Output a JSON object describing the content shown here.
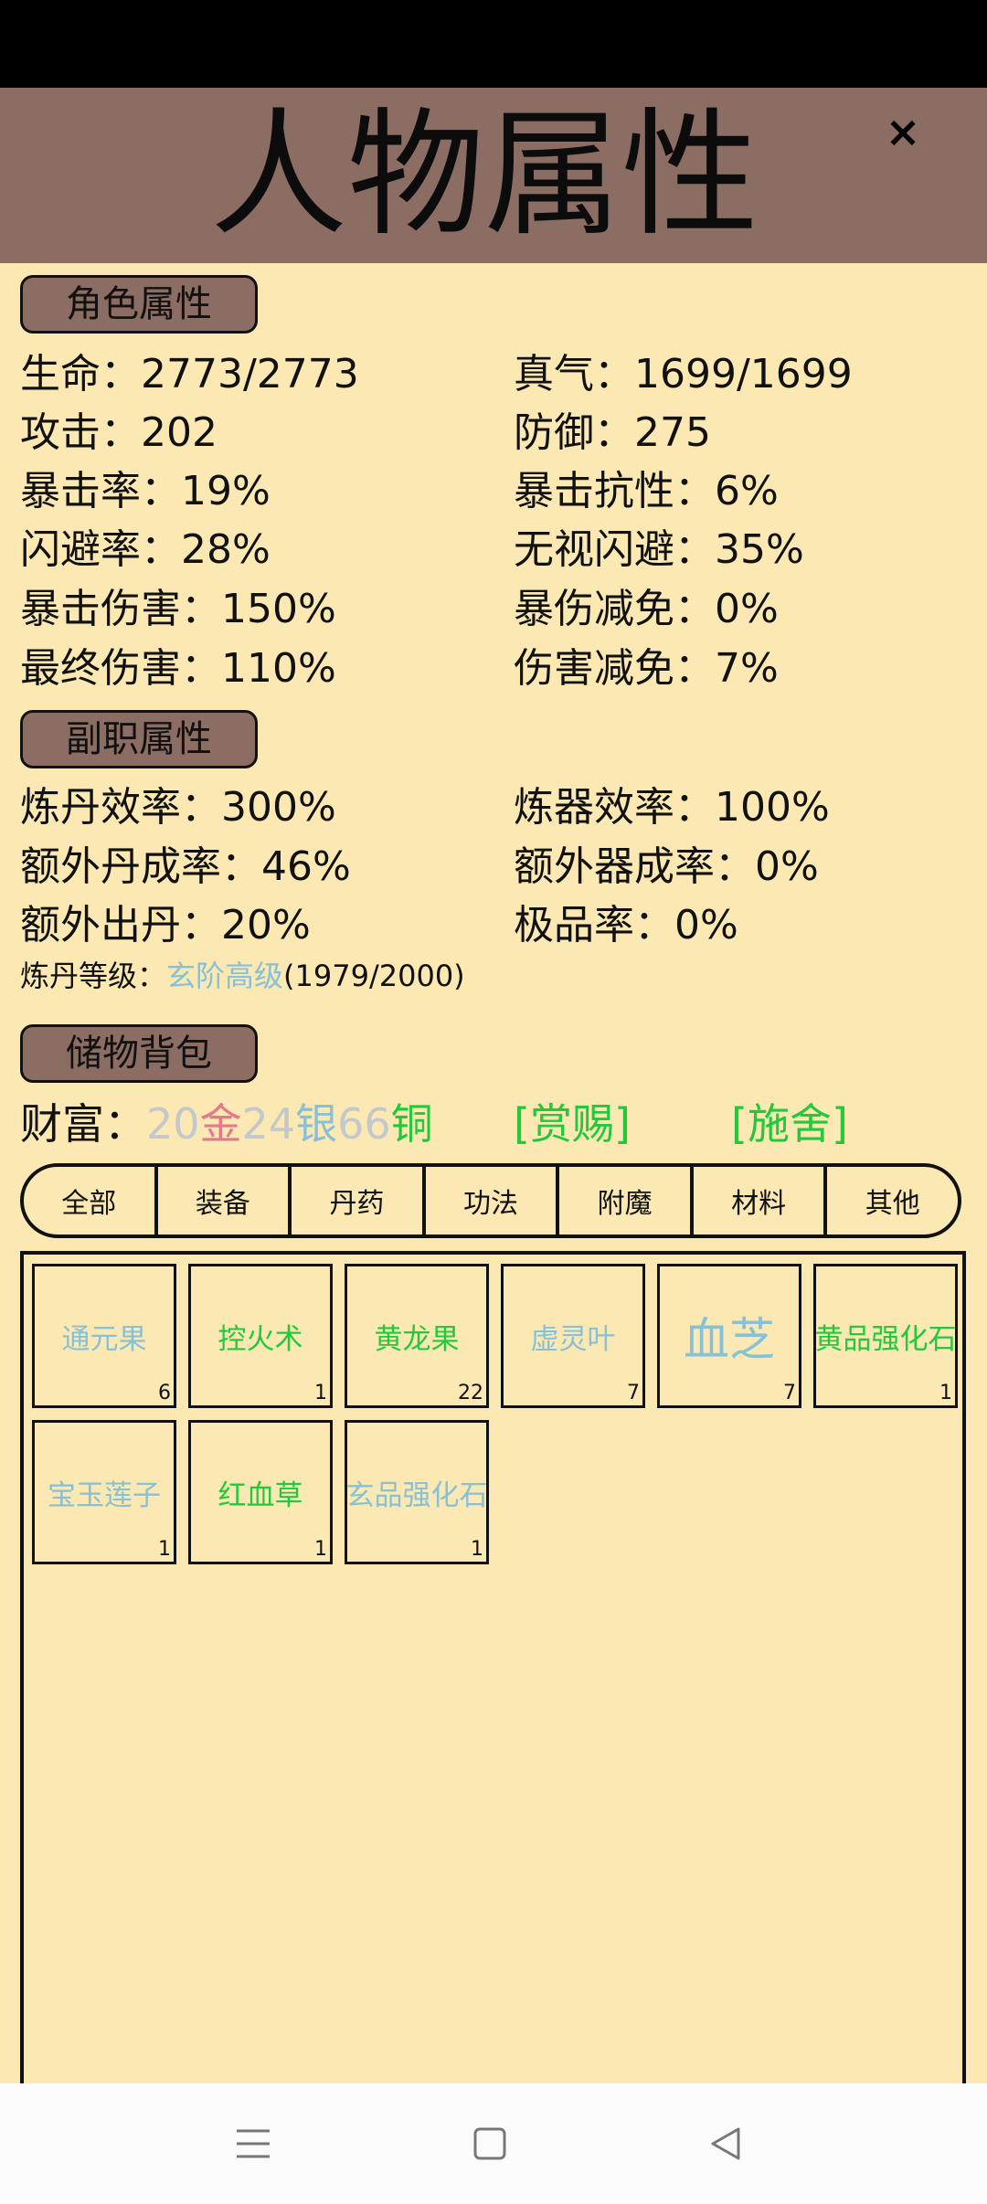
{
  "header": {
    "title": "人物属性",
    "close_label": "×"
  },
  "sections": {
    "character": "角色属性",
    "sub_job": "副职属性",
    "bag": "储物背包"
  },
  "character_stats": {
    "left": [
      "生命：2773/2773",
      "攻击：202",
      "暴击率：19%",
      "闪避率：28%",
      "暴击伤害：150%",
      "最终伤害：110%"
    ],
    "right": [
      "真气：1699/1699",
      "防御：275",
      "暴击抗性：6%",
      "无视闪避：35%",
      "暴伤减免：0%",
      "伤害减免：7%"
    ]
  },
  "sub_stats": {
    "left": [
      "炼丹效率：300%",
      "额外丹成率：46%",
      "额外出丹：20%"
    ],
    "right": [
      "炼器效率：100%",
      "额外器成率：0%",
      "极品率：0%"
    ]
  },
  "alchemy_level": {
    "label": "炼丹等级：",
    "tier": "玄阶高级",
    "progress": "(1979/2000)"
  },
  "wealth": {
    "label": "财富：",
    "gold_amount": "20",
    "gold_unit": "金",
    "silver_amount": "24",
    "silver_unit": "银",
    "copper_amount": "66",
    "copper_unit": "铜",
    "reward_link": "[赏赐]",
    "charity_link": "[施舍]"
  },
  "tabs": [
    "全部",
    "装备",
    "丹药",
    "功法",
    "附魔",
    "材料",
    "其他"
  ],
  "items": [
    {
      "name": "通元果",
      "count": "6",
      "color": "#86c1d7"
    },
    {
      "name": "控火术",
      "count": "1",
      "color": "#22c93a"
    },
    {
      "name": "黄龙果",
      "count": "22",
      "color": "#22c93a"
    },
    {
      "name": "虚灵叶",
      "count": "7",
      "color": "#86c1d7"
    },
    {
      "name": "血芝",
      "count": "7",
      "color": "#86c1d7"
    },
    {
      "name": "黄品强化石",
      "count": "1",
      "color": "#22c93a"
    },
    {
      "name": "宝玉莲子",
      "count": "1",
      "color": "#86c1d7"
    },
    {
      "name": "红血草",
      "count": "1",
      "color": "#22c93a"
    },
    {
      "name": "玄品强化石",
      "count": "1",
      "color": "#86c1d7"
    }
  ],
  "nav": {
    "menu_icon": "menu-icon",
    "home_icon": "home-square-icon",
    "back_icon": "back-triangle-icon"
  }
}
